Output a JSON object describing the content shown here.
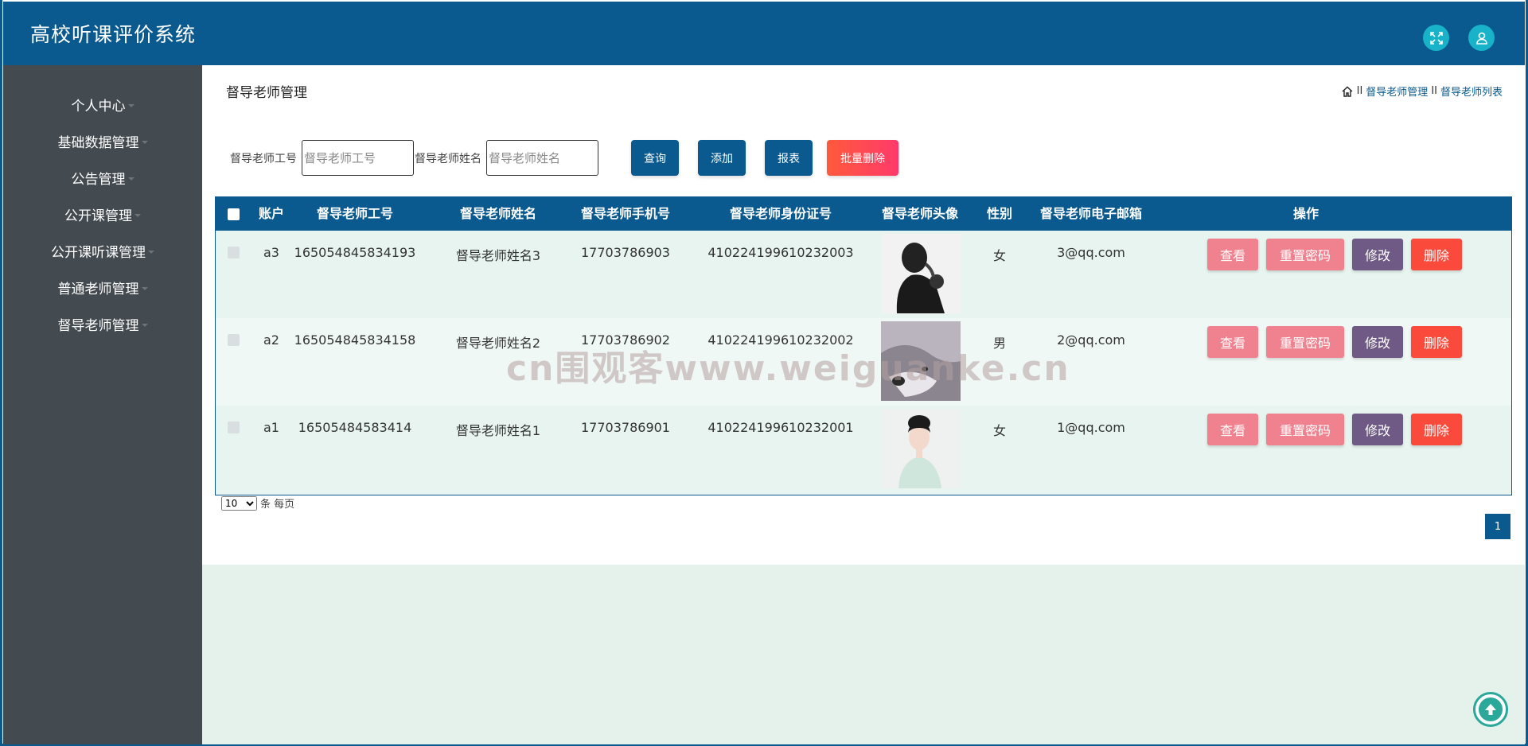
{
  "header": {
    "title": "高校听课评价系统"
  },
  "sidebar": {
    "items": [
      {
        "label": "个人中心"
      },
      {
        "label": "基础数据管理"
      },
      {
        "label": "公告管理"
      },
      {
        "label": "公开课管理"
      },
      {
        "label": "公开课听课管理"
      },
      {
        "label": "普通老师管理"
      },
      {
        "label": "督导老师管理"
      }
    ]
  },
  "page": {
    "title": "督导老师管理",
    "breadcrumb": {
      "sep": "II",
      "level1": "督导老师管理",
      "level2": "督导老师列表"
    }
  },
  "search": {
    "id_label": "督导老师工号",
    "id_placeholder": "督导老师工号",
    "name_label": "督导老师姓名",
    "name_placeholder": "督导老师姓名",
    "query_label": "查询",
    "add_label": "添加",
    "report_label": "报表",
    "batch_delete_label": "批量删除"
  },
  "table": {
    "columns": [
      "账户",
      "督导老师工号",
      "督导老师姓名",
      "督导老师手机号",
      "督导老师身份证号",
      "督导老师头像",
      "性别",
      "督导老师电子邮箱",
      "操作"
    ],
    "actions": {
      "view": "查看",
      "reset": "重置密码",
      "edit": "修改",
      "delete": "删除"
    },
    "rows": [
      {
        "account": "a3",
        "id": "165054845834193",
        "name": "督导老师姓名3",
        "phone": "17703786903",
        "idcard": "410224199610232003",
        "avatar": "man-photo",
        "gender": "女",
        "email": "3@qq.com"
      },
      {
        "account": "a2",
        "id": "165054845834158",
        "name": "督导老师姓名2",
        "phone": "17703786902",
        "idcard": "410224199610232002",
        "avatar": "wolf-photo",
        "gender": "男",
        "email": "2@qq.com"
      },
      {
        "account": "a1",
        "id": "16505484583414",
        "name": "督导老师姓名1",
        "phone": "17703786901",
        "idcard": "410224199610232001",
        "avatar": "woman-photo",
        "gender": "女",
        "email": "1@qq.com"
      }
    ]
  },
  "pagination": {
    "page_size": "10",
    "per_page_text": "条 每页",
    "current_page": "1"
  },
  "watermark": "cn围观客www.weiguanke.cn",
  "colors": {
    "primary": "#0a5a8f",
    "sidebar": "#434a50",
    "accent_cyan": "#18b3c9",
    "danger": "#fa4a3c",
    "pink": "#f0828f",
    "purple": "#6e5a85"
  }
}
